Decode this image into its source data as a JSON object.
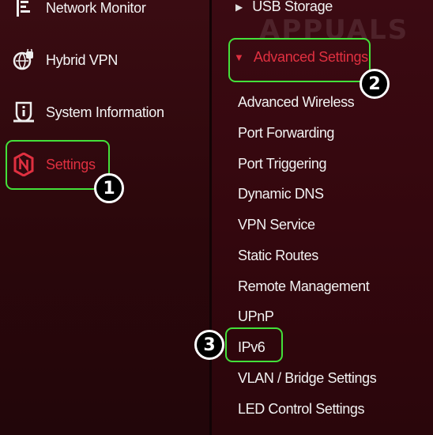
{
  "sidebar": {
    "items": [
      {
        "label": "Network Monitor",
        "icon": "network-monitor-icon"
      },
      {
        "label": "Hybrid VPN",
        "icon": "hybrid-vpn-icon"
      },
      {
        "label": "System Information",
        "icon": "system-information-icon"
      },
      {
        "label": "Settings",
        "icon": "settings-icon",
        "active": true
      }
    ]
  },
  "submenu": {
    "usb_storage": "USB Storage",
    "advanced_settings": "Advanced Settings",
    "items": [
      "Advanced Wireless",
      "Port Forwarding",
      "Port Triggering",
      "Dynamic DNS",
      "VPN Service",
      "Static Routes",
      "Remote Management",
      "UPnP",
      "IPv6",
      "VLAN / Bridge Settings",
      "LED Control Settings"
    ]
  },
  "watermark": "APPUALS",
  "annotations": {
    "step1": "1",
    "step2": "2",
    "step3": "3"
  },
  "colors": {
    "accent_red": "#e03040",
    "highlight_green": "#43e03a",
    "background": "#2a070b"
  }
}
